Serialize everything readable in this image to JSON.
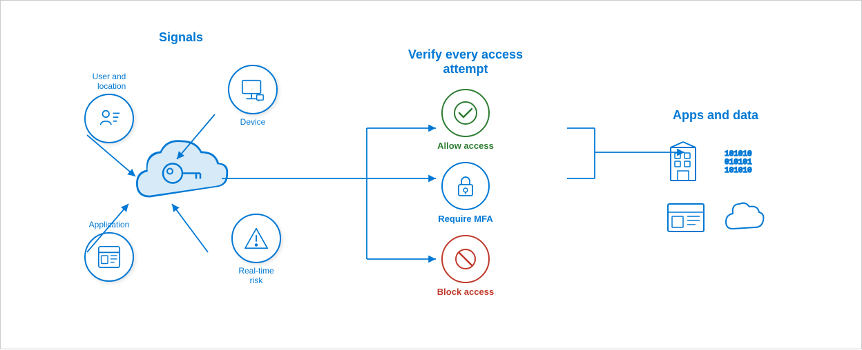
{
  "sections": {
    "signals": {
      "title": "Signals",
      "items": [
        {
          "id": "user-location",
          "label": "User and\nlocation",
          "icon": "user-list"
        },
        {
          "id": "device",
          "label": "Device",
          "icon": "monitor"
        },
        {
          "id": "application",
          "label": "Application",
          "icon": "app"
        },
        {
          "id": "risk",
          "label": "Real-time\nrisk",
          "icon": "warning"
        }
      ]
    },
    "verify": {
      "title": "Verify every access\nattempt",
      "outcomes": [
        {
          "id": "allow",
          "label": "Allow access",
          "type": "allow"
        },
        {
          "id": "mfa",
          "label": "Require MFA",
          "type": "mfa"
        },
        {
          "id": "block",
          "label": "Block access",
          "type": "block"
        }
      ]
    },
    "apps": {
      "title": "Apps and data",
      "items": [
        {
          "id": "building",
          "label": ""
        },
        {
          "id": "data-bits",
          "label": ""
        },
        {
          "id": "app-window",
          "label": ""
        },
        {
          "id": "cloud-data",
          "label": ""
        }
      ]
    }
  }
}
